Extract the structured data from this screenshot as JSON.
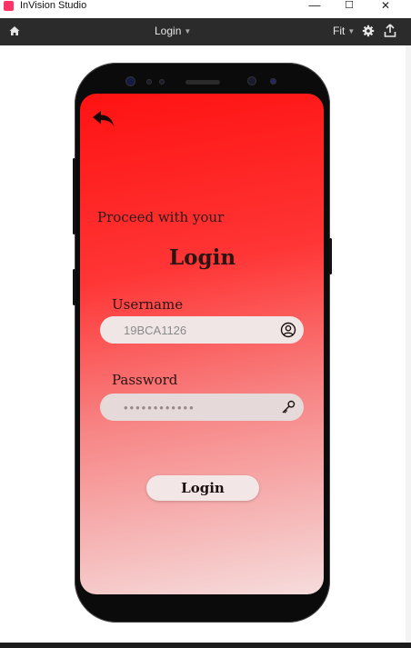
{
  "window": {
    "app_title": "InVision Studio",
    "minimize_glyph": "—",
    "maximize_glyph": "☐",
    "close_glyph": "✕"
  },
  "toolbar": {
    "screen_name": "Login",
    "zoom": "Fit",
    "icons": [
      "home-icon",
      "gear-icon",
      "upload-icon"
    ]
  },
  "screen": {
    "gradient_top": "#ff1212",
    "gradient_bottom": "#f6dcdc",
    "proceed_text": "Proceed with your",
    "heading": "Login",
    "username": {
      "label": "Username",
      "value": "19BCA1126",
      "icon": "user-circle-icon"
    },
    "password": {
      "label": "Password",
      "value": "••••••••••••",
      "icon": "key-icon"
    },
    "login_button": "Login",
    "back_icon": "back-arrow-icon"
  }
}
